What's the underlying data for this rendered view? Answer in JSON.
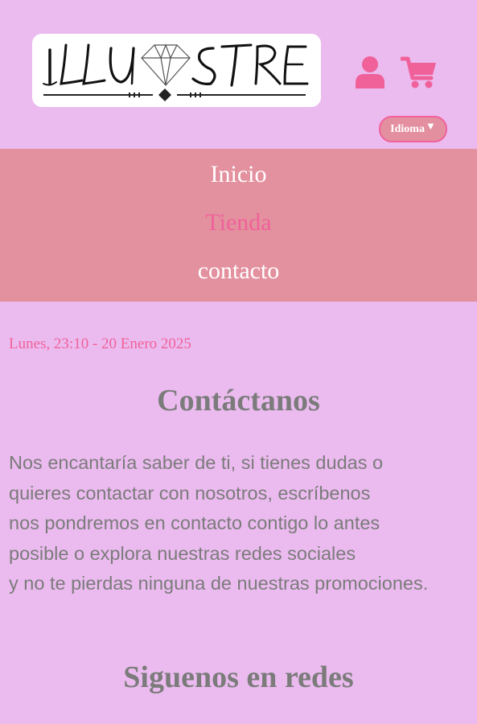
{
  "header": {
    "logo_text": "ILLUSTRE",
    "idioma_label": "Idioma",
    "idioma_arrow": "▼",
    "icons": [
      "user-icon",
      "cart-icon"
    ]
  },
  "nav": {
    "items": [
      {
        "label": "Inicio",
        "active": false
      },
      {
        "label": "Tienda",
        "active": true
      },
      {
        "label": "contacto",
        "active": false
      }
    ]
  },
  "main": {
    "date": "Lunes, 23:10 - 20 Enero 2025",
    "contact_title": "Contáctanos",
    "paragraph_lines": [
      "Nos encantaría saber de ti, si tienes dudas o",
      "quieres contactar con nosotros, escríbenos",
      "nos pondremos en contacto contigo lo antes",
      "posible o explora nuestras redes sociales",
      "y no te pierdas ninguna de nuestras promociones."
    ],
    "social_title": "Siguenos en redes"
  },
  "colors": {
    "background": "#ebbbef",
    "nav_background": "#e3919f",
    "accent_pink": "#f0619a",
    "text_gray": "#7b7b7b",
    "white": "#ffffff"
  }
}
